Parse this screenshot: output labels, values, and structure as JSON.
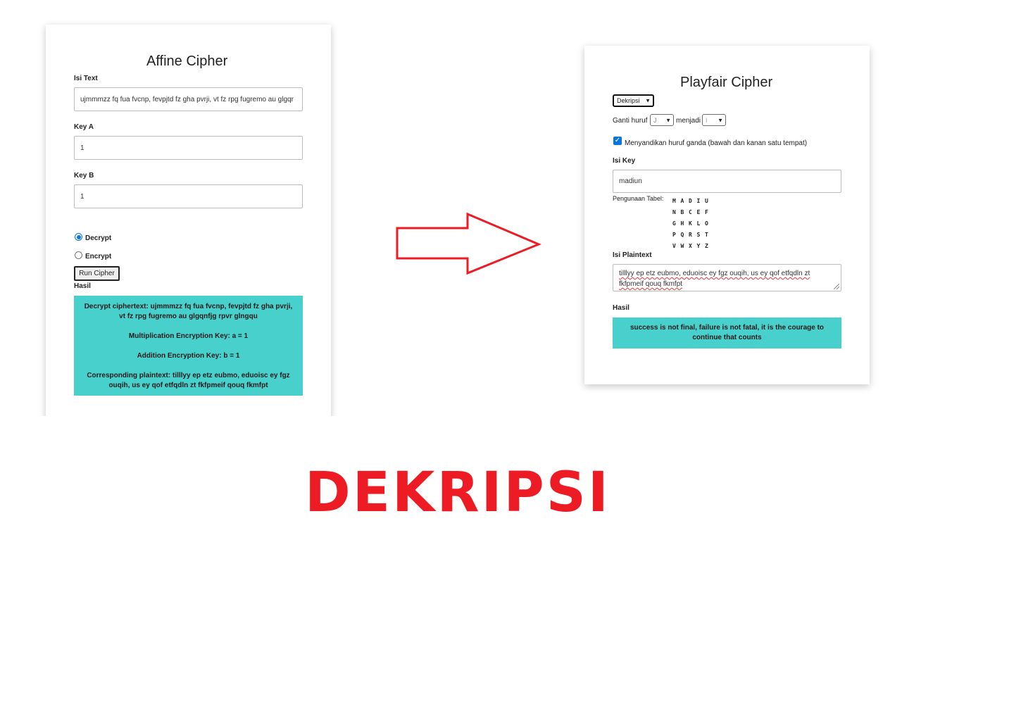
{
  "affine": {
    "title": "Affine Cipher",
    "text_label": "Isi Text",
    "text_value": "ujmmmzz fq fua fvcnp, fevpjtd fz gha pvrji, vt fz rpg fugremo au glgqr",
    "key_a_label": "Key A",
    "key_a_value": "1",
    "key_b_label": "Key B",
    "key_b_value": "1",
    "radio_decrypt": "Decrypt",
    "radio_encrypt": "Encrypt",
    "selected_mode": "Decrypt",
    "run_button": "Run Cipher",
    "result_label": "Hasil",
    "result_lines": [
      "Decrypt ciphertext: ujmmmzz fq fua fvcnp, fevpjtd fz gha pvrji, vt fz rpg fugremo au glgqnfjg rpvr glngqu",
      "Multiplication Encryption Key: a = 1",
      "Addition Encryption Key: b = 1",
      "Corresponding plaintext: tilllyy ep etz eubmo, eduoisc ey fgz ouqih, us ey qof etfqdln zt fkfpmeif qouq fkmfpt"
    ]
  },
  "playfair": {
    "title": "Playfair Cipher",
    "mode_select": "Dekripsi",
    "replace_label": "Ganti huruf",
    "replace_from": "J",
    "replace_to_label": "menjadi",
    "replace_to": "I",
    "double_checkbox_checked": true,
    "double_checkbox_label": "Menyandikan huruf ganda (bawah dan kanan satu tempat)",
    "key_label": "Isi Key",
    "key_value": "madiun",
    "table_label": "Pengunaan Tabel:",
    "table": [
      [
        "M",
        "A",
        "D",
        "I",
        "U"
      ],
      [
        "N",
        "B",
        "C",
        "E",
        "F"
      ],
      [
        "G",
        "H",
        "K",
        "L",
        "O"
      ],
      [
        "P",
        "Q",
        "R",
        "S",
        "T"
      ],
      [
        "V",
        "W",
        "X",
        "Y",
        "Z"
      ]
    ],
    "plaintext_label": "Isi Plaintext",
    "plaintext_line1": "tilllyy ep etz eubmo, eduoisc ey fgz ouqih, us ey qof etfqdln zt",
    "plaintext_line2": "fkfpmeif qouq fkmfpt",
    "result_label": "Hasil",
    "result_text": "success is not final, failure is not fatal, it is the courage to continue that counts"
  },
  "caption": "DEKRIPSI",
  "colors": {
    "result_bg": "#48d1cc",
    "arrow": "#ed1c24",
    "caption": "#ed1c24",
    "accent": "#0b74de"
  }
}
